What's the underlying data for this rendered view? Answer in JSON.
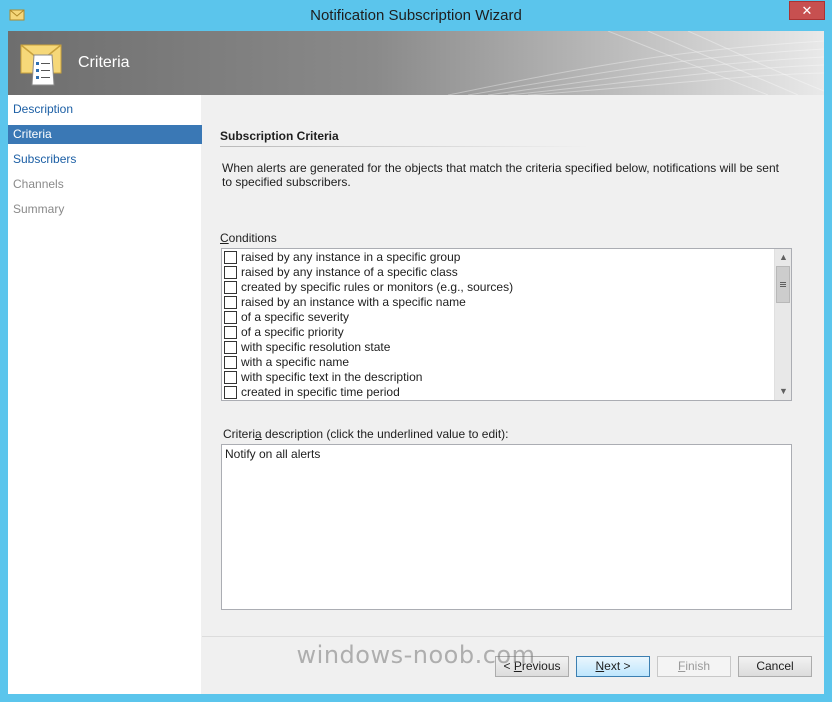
{
  "window": {
    "title": "Notification Subscription Wizard",
    "close_glyph": "✕"
  },
  "banner": {
    "title": "Criteria"
  },
  "nav": {
    "items": [
      {
        "label": "Description",
        "state": "link"
      },
      {
        "label": "Criteria",
        "state": "active"
      },
      {
        "label": "Subscribers",
        "state": "link"
      },
      {
        "label": "Channels",
        "state": "disabled"
      },
      {
        "label": "Summary",
        "state": "disabled"
      }
    ]
  },
  "main": {
    "section_title": "Subscription Criteria",
    "intro": "When alerts are generated for the objects that match the criteria specified below, notifications will be sent to specified subscribers.",
    "conditions_label": {
      "pre": "",
      "accel": "C",
      "post": "onditions"
    },
    "conditions": [
      {
        "label": "raised by any instance in a specific group",
        "checked": false
      },
      {
        "label": "raised by any instance of a specific class",
        "checked": false
      },
      {
        "label": "created by specific rules or monitors (e.g., sources)",
        "checked": false
      },
      {
        "label": "raised by an instance with a specific name",
        "checked": false
      },
      {
        "label": "of a specific severity",
        "checked": false
      },
      {
        "label": "of a specific priority",
        "checked": false
      },
      {
        "label": "with specific resolution state",
        "checked": false
      },
      {
        "label": "with a specific name",
        "checked": false
      },
      {
        "label": "with specific text in the description",
        "checked": false
      },
      {
        "label": "created in specific time period",
        "checked": false
      }
    ],
    "criteria_label": {
      "pre": "Criteri",
      "accel": "a",
      "post": " description (click the underlined value to edit):"
    },
    "criteria_text": "Notify on all alerts"
  },
  "buttons": {
    "previous": {
      "pre": "< ",
      "accel": "P",
      "post": "revious"
    },
    "next": {
      "pre": "",
      "accel": "N",
      "post": "ext >"
    },
    "finish": {
      "pre": "",
      "accel": "F",
      "post": "inish"
    },
    "cancel": "Cancel"
  },
  "watermark": "windows-noob.com",
  "colors": {
    "titlebar": "#5bc5ec",
    "nav_active": "#3a78b5",
    "link": "#1c5fa5",
    "close": "#c75050"
  }
}
